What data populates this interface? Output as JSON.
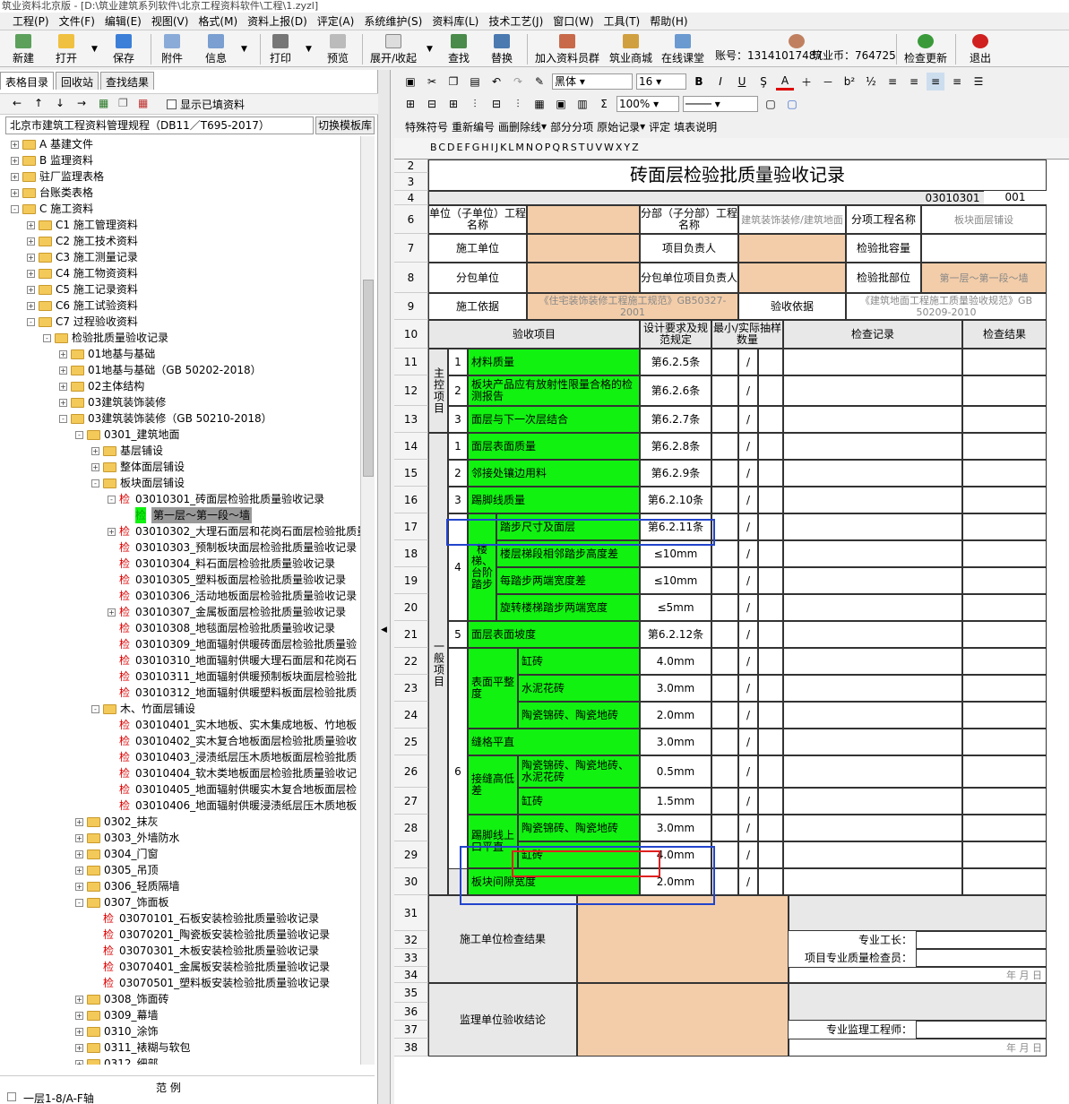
{
  "window": {
    "title": "筑业资料北京版 - [D:\\筑业建筑系列软件\\北京工程资料软件\\工程\\1.zyzl]"
  },
  "menu": [
    "工程(P)",
    "文件(F)",
    "编辑(E)",
    "视图(V)",
    "格式(M)",
    "资料上报(D)",
    "评定(A)",
    "系统维护(S)",
    "资料库(L)",
    "技术工艺(J)",
    "窗口(W)",
    "工具(T)",
    "帮助(H)"
  ],
  "toolbar": {
    "new": "新建",
    "open": "打开",
    "save": "保存",
    "attach": "附件",
    "info": "信息",
    "print": "打印",
    "preview": "预览",
    "expand": "展开/收起",
    "find": "查找",
    "replace": "替换",
    "join": "加入资料员群",
    "mall": "筑业商城",
    "class": "在线课堂",
    "account": "账号：13141017487",
    "coins": "筑业币：764725",
    "update": "检查更新",
    "exit": "退出"
  },
  "left": {
    "tabs": [
      "表格目录",
      "回收站",
      "查找结果"
    ],
    "show_filled": "显示已填资料",
    "spec": "北京市建筑工程资料管理规程（DB11／T695-2017）",
    "switch_btn": "切换模板库",
    "legend": "范    例",
    "bottom_item": "一层1-8/A-F轴",
    "tree": [
      {
        "d": 0,
        "e": "+",
        "f": 1,
        "t": "A 基建文件"
      },
      {
        "d": 0,
        "e": "+",
        "f": 1,
        "t": "B 监理资料"
      },
      {
        "d": 0,
        "e": "+",
        "f": 1,
        "t": "驻厂监理表格"
      },
      {
        "d": 0,
        "e": "+",
        "f": 1,
        "t": "台账类表格"
      },
      {
        "d": 0,
        "e": "-",
        "f": 1,
        "t": "C 施工资料"
      },
      {
        "d": 1,
        "e": "+",
        "f": 1,
        "t": "C1 施工管理资料"
      },
      {
        "d": 1,
        "e": "+",
        "f": 1,
        "t": "C2 施工技术资料"
      },
      {
        "d": 1,
        "e": "+",
        "f": 1,
        "t": "C3 施工测量记录"
      },
      {
        "d": 1,
        "e": "+",
        "f": 1,
        "t": "C4 施工物资资料"
      },
      {
        "d": 1,
        "e": "+",
        "f": 1,
        "t": "C5 施工记录资料"
      },
      {
        "d": 1,
        "e": "+",
        "f": 1,
        "t": "C6 施工试验资料"
      },
      {
        "d": 1,
        "e": "-",
        "f": 1,
        "t": "C7 过程验收资料"
      },
      {
        "d": 2,
        "e": "-",
        "f": 1,
        "t": "检验批质量验收记录"
      },
      {
        "d": 3,
        "e": "+",
        "f": 1,
        "t": "01地基与基础"
      },
      {
        "d": 3,
        "e": "+",
        "f": 1,
        "t": "01地基与基础（GB 50202-2018）"
      },
      {
        "d": 3,
        "e": "+",
        "f": 1,
        "t": "02主体结构"
      },
      {
        "d": 3,
        "e": "+",
        "f": 1,
        "t": "03建筑装饰装修"
      },
      {
        "d": 3,
        "e": "-",
        "f": 1,
        "t": "03建筑装饰装修（GB 50210-2018）"
      },
      {
        "d": 4,
        "e": "-",
        "f": 1,
        "t": "0301_建筑地面"
      },
      {
        "d": 5,
        "e": "+",
        "f": 1,
        "t": "基层铺设"
      },
      {
        "d": 5,
        "e": "+",
        "f": 1,
        "t": "整体面层铺设"
      },
      {
        "d": 5,
        "e": "-",
        "f": 1,
        "t": "板块面层铺设"
      },
      {
        "d": 6,
        "e": "-",
        "j": "检",
        "t": "03010301_砖面层检验批质量验收记录"
      },
      {
        "d": 7,
        "j": "检",
        "g": 1,
        "t": "第一层～第一段～墙",
        "sel": 1
      },
      {
        "d": 6,
        "e": "+",
        "j": "检",
        "t": "03010302_大理石面层和花岗石面层检验批质量"
      },
      {
        "d": 6,
        "j": "检",
        "t": "03010303_预制板块面层检验批质量验收记录"
      },
      {
        "d": 6,
        "j": "检",
        "t": "03010304_料石面层检验批质量验收记录"
      },
      {
        "d": 6,
        "j": "检",
        "t": "03010305_塑料板面层检验批质量验收记录"
      },
      {
        "d": 6,
        "j": "检",
        "t": "03010306_活动地板面层检验批质量验收记录"
      },
      {
        "d": 6,
        "e": "+",
        "j": "检",
        "t": "03010307_金属板面层检验批质量验收记录"
      },
      {
        "d": 6,
        "j": "检",
        "t": "03010308_地毯面层检验批质量验收记录"
      },
      {
        "d": 6,
        "j": "检",
        "t": "03010309_地面辐射供暖砖面层检验批质量验"
      },
      {
        "d": 6,
        "j": "检",
        "t": "03010310_地面辐射供暖大理石面层和花岗石"
      },
      {
        "d": 6,
        "j": "检",
        "t": "03010311_地面辐射供暖预制板块面层检验批"
      },
      {
        "d": 6,
        "j": "检",
        "t": "03010312_地面辐射供暖塑料板面层检验批质"
      },
      {
        "d": 5,
        "e": "-",
        "f": 1,
        "t": "木、竹面层铺设"
      },
      {
        "d": 6,
        "j": "检",
        "t": "03010401_实木地板、实木集成地板、竹地板"
      },
      {
        "d": 6,
        "j": "检",
        "t": "03010402_实木复合地板面层检验批质量验收"
      },
      {
        "d": 6,
        "j": "检",
        "t": "03010403_浸渍纸层压木质地板面层检验批质"
      },
      {
        "d": 6,
        "j": "检",
        "t": "03010404_软木类地板面层检验批质量验收记"
      },
      {
        "d": 6,
        "j": "检",
        "t": "03010405_地面辐射供暖实木复合地板面层检"
      },
      {
        "d": 6,
        "j": "检",
        "t": "03010406_地面辐射供暖浸渍纸层压木质地板"
      },
      {
        "d": 4,
        "e": "+",
        "f": 1,
        "t": "0302_抹灰"
      },
      {
        "d": 4,
        "e": "+",
        "f": 1,
        "t": "0303_外墙防水"
      },
      {
        "d": 4,
        "e": "+",
        "f": 1,
        "t": "0304_门窗"
      },
      {
        "d": 4,
        "e": "+",
        "f": 1,
        "t": "0305_吊顶"
      },
      {
        "d": 4,
        "e": "+",
        "f": 1,
        "t": "0306_轻质隔墙"
      },
      {
        "d": 4,
        "e": "-",
        "f": 1,
        "t": "0307_饰面板"
      },
      {
        "d": 5,
        "j": "检",
        "t": "03070101_石板安装检验批质量验收记录"
      },
      {
        "d": 5,
        "j": "检",
        "t": "03070201_陶瓷板安装检验批质量验收记录"
      },
      {
        "d": 5,
        "j": "检",
        "t": "03070301_木板安装检验批质量验收记录"
      },
      {
        "d": 5,
        "j": "检",
        "t": "03070401_金属板安装检验批质量验收记录"
      },
      {
        "d": 5,
        "j": "检",
        "t": "03070501_塑料板安装检验批质量验收记录"
      },
      {
        "d": 4,
        "e": "+",
        "f": 1,
        "t": "0308_饰面砖"
      },
      {
        "d": 4,
        "e": "+",
        "f": 1,
        "t": "0309_幕墙"
      },
      {
        "d": 4,
        "e": "+",
        "f": 1,
        "t": "0310_涂饰"
      },
      {
        "d": 4,
        "e": "+",
        "f": 1,
        "t": "0311_裱糊与软包"
      },
      {
        "d": 4,
        "e": "+",
        "f": 1,
        "t": "0312_细部"
      }
    ]
  },
  "format": {
    "font": "黑体",
    "size": "16",
    "zoom": "100%",
    "row3": [
      "特殊符号",
      "重新编号",
      "画删除线",
      "部分分项",
      "原始记录",
      "评定",
      "填表说明"
    ]
  },
  "sheet": {
    "col_header": "BCDEFGHIJKLMNOPQRSTUVWXYZ",
    "title": "砖面层检验批质量验收记录",
    "code": "03010301",
    "code_num": "001",
    "unit_label": "单位（子单位）工程名称",
    "subpart_label": "分部（子分部）工程名称",
    "subpart_val": "建筑装饰装修/建筑地面",
    "subitem_label": "分项工程名称",
    "subitem_val": "板块面层铺设",
    "contractor_label": "施工单位",
    "pm_label": "项目负责人",
    "capacity_label": "检验批容量",
    "subcontractor_label": "分包单位",
    "sub_pm_label": "分包单位项目负责人",
    "location_label": "检验批部位",
    "location_val": "第一层～第一段～墙",
    "basis_label": "施工依据",
    "basis_val": "《住宅装饰装修工程施工规范》GB50327-2001",
    "accept_basis_label": "验收依据",
    "accept_basis_val": "《建筑地面工程施工质量验收规范》GB 50209-2010",
    "hdr_item": "验收项目",
    "hdr_design": "设计要求及规范规定",
    "hdr_sample": "最小/实际抽样数量",
    "hdr_record": "检查记录",
    "hdr_result": "检查结果",
    "main_ctrl": "主控项目",
    "general": "一般项目",
    "slash": "/",
    "m1": "材料质量",
    "m1v": "第6.2.5条",
    "m2": "板块产品应有放射性限量合格的检测报告",
    "m2v": "第6.2.6条",
    "m3": "面层与下一次层结合",
    "m3v": "第6.2.7条",
    "g1": "面层表面质量",
    "g1v": "第6.2.8条",
    "g2": "邻接处镶边用料",
    "g2v": "第6.2.9条",
    "g3": "踢脚线质量",
    "g3v": "第6.2.10条",
    "g4": "楼梯、台阶踏步",
    "g4a": "踏步尺寸及面层",
    "g4av": "第6.2.11条",
    "g4b": "楼层梯段相邻踏步高度差",
    "g4bv": "≤10mm",
    "g4c": "每踏步两端宽度差",
    "g4cv": "≤10mm",
    "g4d": "旋转楼梯踏步两端宽度",
    "g4dv": "≤5mm",
    "g5": "面层表面坡度",
    "g5v": "第6.2.12条",
    "g6a": "表面平整度",
    "g6a1": "缸砖",
    "g6a1v": "4.0mm",
    "g6a2": "水泥花砖",
    "g6a2v": "3.0mm",
    "g6a3": "陶瓷锦砖、陶瓷地砖",
    "g6a3v": "2.0mm",
    "g6b": "缝格平直",
    "g6bv": "3.0mm",
    "g6c": "接缝高低差",
    "g6c1": "陶瓷锦砖、陶瓷地砖、水泥花砖",
    "g6c1v": "0.5mm",
    "g6c2": "缸砖",
    "g6c2v": "1.5mm",
    "g6d": "踢脚线上口平直",
    "g6d1": "陶瓷锦砖、陶瓷地砖",
    "g6d1v": "3.0mm",
    "g6d2": "缸砖",
    "g6d2v": "4.0mm",
    "g6e": "板块间隙宽度",
    "g6ev": "2.0mm",
    "n1": "1",
    "n2": "2",
    "n3": "3",
    "n4": "4",
    "n5": "5",
    "n6": "6",
    "contractor_result": "施工单位检查结果",
    "foreman": "专业工长：",
    "qc": "项目专业质量检查员：",
    "date": "年  月  日",
    "supervisor_result": "监理单位验收结论",
    "engineer": "专业监理工程师："
  },
  "colors": {
    "green": "#11f211",
    "orange": "#f3cda9",
    "highlight_blue": "#2244cc",
    "highlight_red": "#e02020"
  }
}
